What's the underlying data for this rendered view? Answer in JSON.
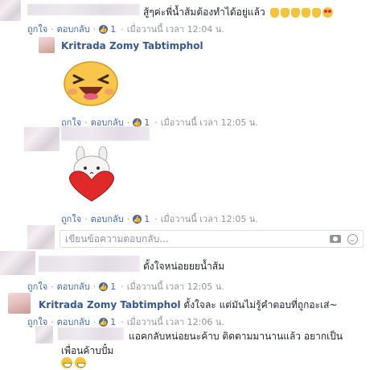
{
  "comments": [
    {
      "text": "สู้ๆค่ะพี่น้ำส้มต้องทำได้อยู่แล้ว",
      "meta": {
        "like": "ถูกใจ",
        "reply": "ตอบกลับ",
        "likes": "1",
        "time": "เมื่อวานนี้ เวลา 12:04 น."
      }
    },
    {
      "name": "Kritrada Zomy Tabtimphol",
      "sticker": "laughing-sticker",
      "meta": {
        "like": "ถูกใจ",
        "reply": "ตอบกลับ",
        "likes": "1",
        "time": "เมื่อวานนี้ เวลา 12:05 น."
      }
    },
    {
      "sticker": "bunny-heart-sticker",
      "meta": {
        "like": "ถูกใจ",
        "reply": "ตอบกลับ",
        "likes": "1",
        "time": "เมื่อวานนี้ เวลา 12:05 น."
      }
    },
    {
      "text": "ตั้งใจหน่อยยยน้ำส้ม",
      "meta": {
        "like": "ถูกใจ",
        "reply": "ตอบกลับ",
        "likes": "1",
        "time": "เมื่อวานนี้ เวลา 12:05 น."
      }
    },
    {
      "name": "Kritrada Zomy Tabtimphol",
      "text": "ตั้งใจละ แต่มันไม่รู้คำตอบที่ถูกอะเส่~",
      "meta": {
        "like": "ถูกใจ",
        "reply": "ตอบกลับ",
        "likes": "1",
        "time": "เมื่อวานนี้ เวลา 12:06 น."
      }
    },
    {
      "text_line1": "แอคกลับหน่อยนะค้าบ ติดตามมานานแล้ว อยากเป็น",
      "text_line2": "เพื่อนค้าบปั๋ม"
    }
  ],
  "reply_box": {
    "placeholder": "เขียนข้อความตอบกลับ..."
  },
  "colors": {
    "link": "#365899",
    "meta_link": "#4267b2",
    "meta_text": "#90949c"
  }
}
